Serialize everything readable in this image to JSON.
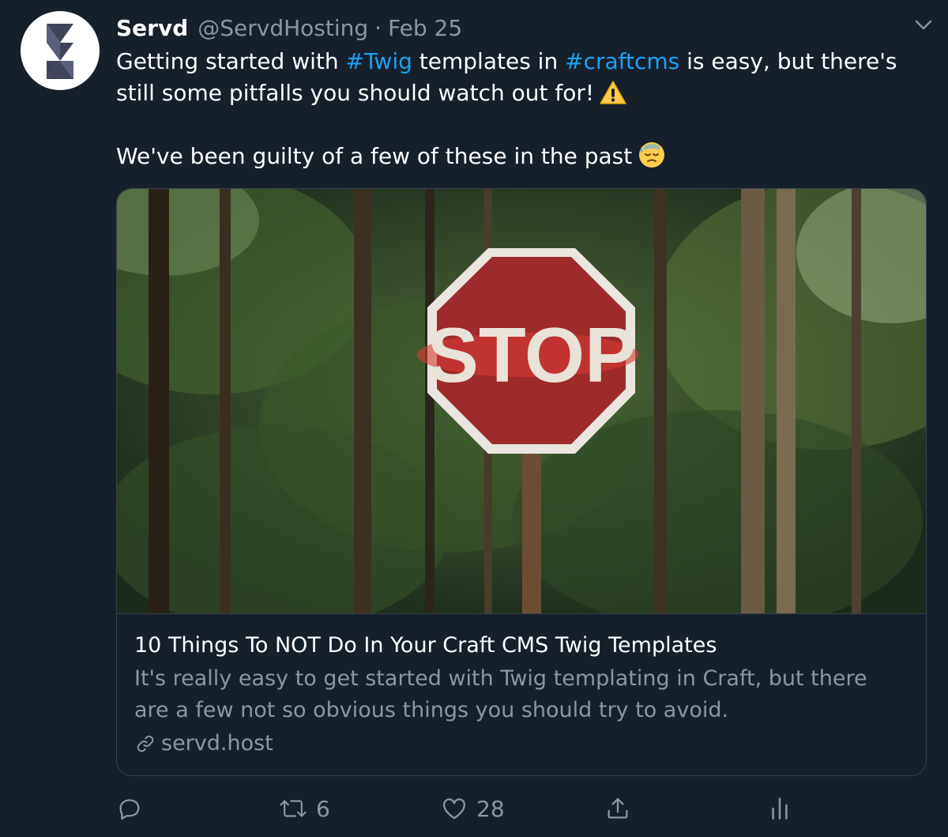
{
  "tweet": {
    "author_name": "Servd",
    "handle": "@ServdHosting",
    "separator": "·",
    "date": "Feb 25",
    "text": {
      "p1_part1": "Getting started with ",
      "hashtag1": "#Twig",
      "p1_part2": " templates in ",
      "hashtag2": "#craftcms",
      "p1_part3": " is easy, but there's still some pitfalls you should watch out for!",
      "p2": "We've been guilty of a few of these in the past"
    },
    "emojis": [
      "warning-emoji",
      "sweat-emoji"
    ]
  },
  "card": {
    "image_sign_text": "STOP",
    "title": "10 Things To NOT Do In Your Craft CMS Twig Templates",
    "description": "It's really easy to get started with Twig templating in Craft, but there are a few not so obvious things you should try to avoid.",
    "domain": "servd.host"
  },
  "actions": {
    "reply_count": "",
    "retweet_count": "6",
    "like_count": "28"
  },
  "icons": [
    "chevron-down-icon",
    "reply-icon",
    "retweet-icon",
    "like-icon",
    "share-icon",
    "analytics-icon",
    "link-icon"
  ],
  "colors": {
    "background": "#15202b",
    "text": "#ffffff",
    "secondary": "#8899a6",
    "accent": "#1da1f2",
    "border": "#38444d"
  }
}
